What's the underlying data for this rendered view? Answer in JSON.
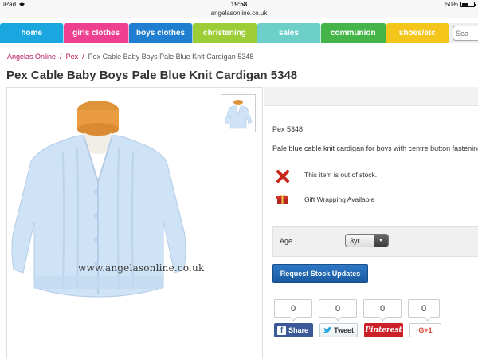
{
  "status": {
    "carrier": "iPad",
    "time": "19:58",
    "battery": "50%",
    "battery_level": 0.5
  },
  "url": "angelasonline.co.uk",
  "nav": [
    {
      "label": "home",
      "color": "#1aa7e0"
    },
    {
      "label": "girls clothes",
      "color": "#ee3f90"
    },
    {
      "label": "boys clothes",
      "color": "#1f7ed0"
    },
    {
      "label": "christening",
      "color": "#9ccd37"
    },
    {
      "label": "sales",
      "color": "#6cd0c9"
    },
    {
      "label": "communion",
      "color": "#46b549"
    },
    {
      "label": "shoes/etc",
      "color": "#f4c51a"
    }
  ],
  "search_placeholder": "Sea",
  "breadcrumb": {
    "home": "Angelas Online",
    "category": "Pex",
    "current": "Pex Cable Baby Boys Pale Blue Knit Cardigan 5348"
  },
  "product": {
    "title": "Pex Cable Baby Boys Pale Blue Knit Cardigan 5348",
    "code": "Pex 5348",
    "description": "Pale blue cable knit cardigan for boys with centre button fastening",
    "watermark": "www.angelasonline.co.uk",
    "stock_message": "This item is out of stock.",
    "gift_message": "Gift Wrapping Available"
  },
  "options": {
    "age_label": "Age",
    "age_value": "3yr"
  },
  "buttons": {
    "stock_updates": "Request Stock Updates"
  },
  "social": {
    "counts": [
      "0",
      "0",
      "0",
      "0"
    ],
    "facebook": "Share",
    "twitter": "Tweet",
    "pinterest": "Pinterest",
    "google": "G+1"
  }
}
